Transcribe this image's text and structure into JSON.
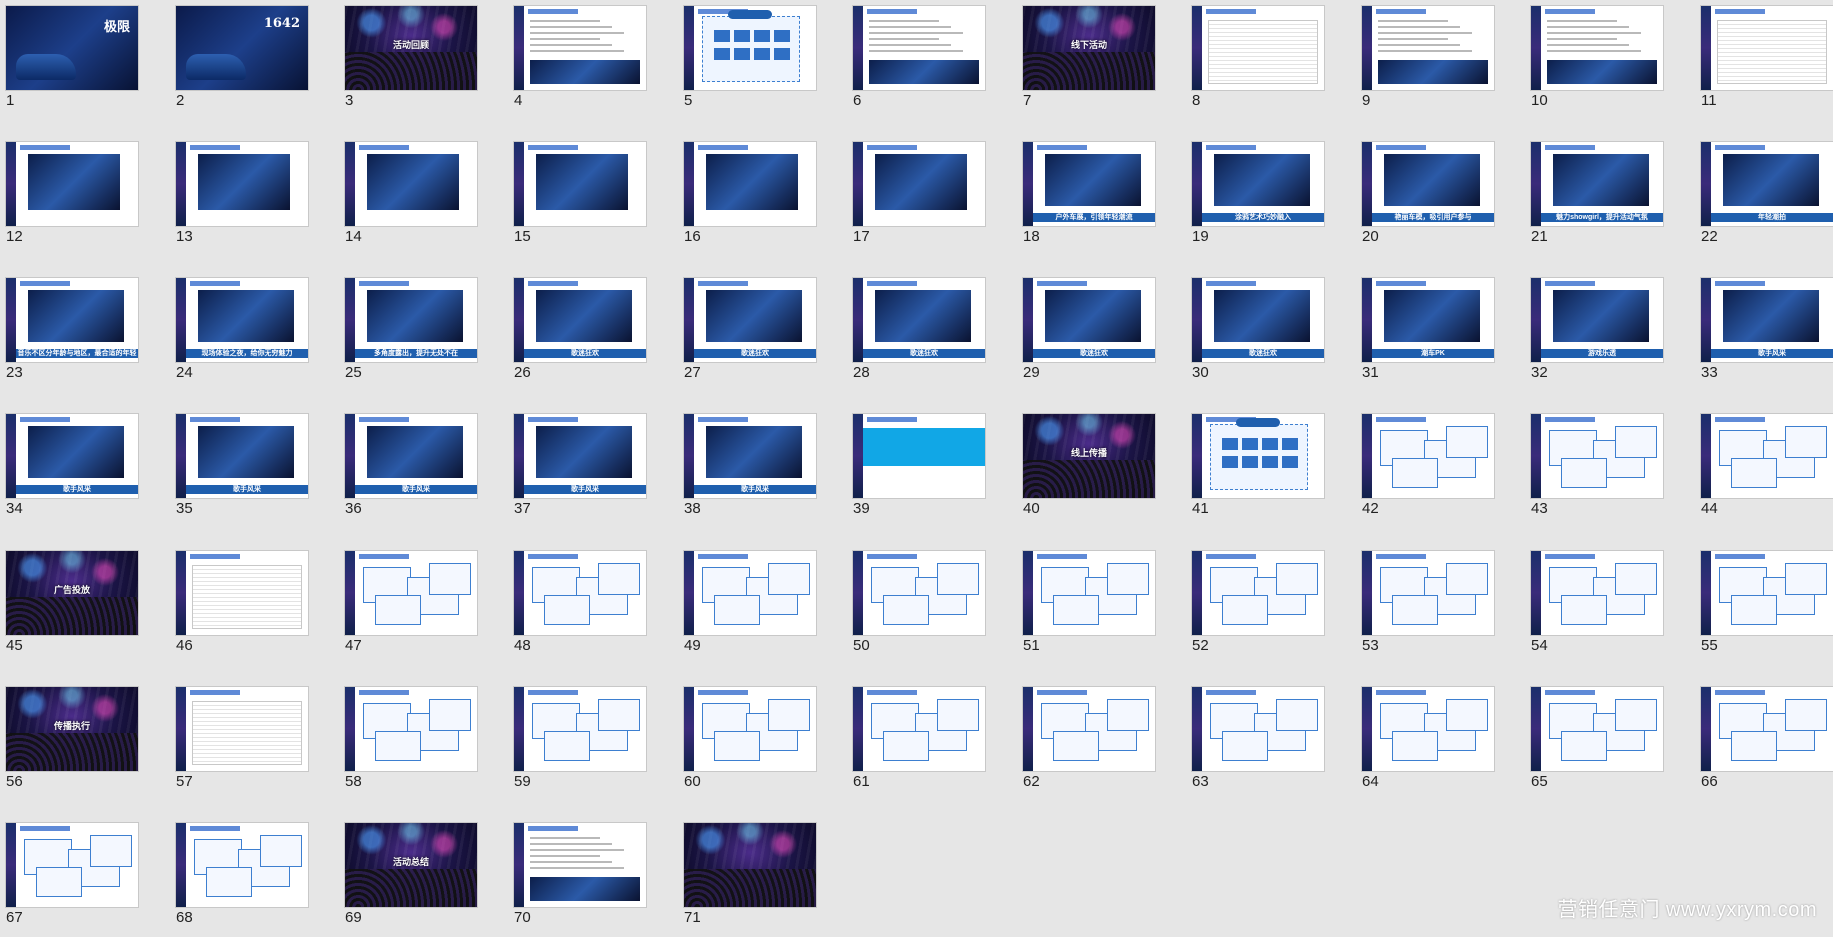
{
  "slides": [
    {
      "n": "1",
      "kind": "title",
      "caption": "",
      "word": "极限"
    },
    {
      "n": "2",
      "kind": "title",
      "caption": "",
      "word": "1642"
    },
    {
      "n": "3",
      "kind": "dark",
      "caption": "活动回顾"
    },
    {
      "n": "4",
      "kind": "doc",
      "caption": ""
    },
    {
      "n": "5",
      "kind": "blue",
      "caption": ""
    },
    {
      "n": "6",
      "kind": "doc",
      "caption": ""
    },
    {
      "n": "7",
      "kind": "dark",
      "caption": "线下活动"
    },
    {
      "n": "8",
      "kind": "table",
      "caption": ""
    },
    {
      "n": "9",
      "kind": "doc",
      "caption": ""
    },
    {
      "n": "10",
      "kind": "doc",
      "caption": ""
    },
    {
      "n": "11",
      "kind": "table",
      "caption": ""
    },
    {
      "n": "12",
      "kind": "photo",
      "caption": ""
    },
    {
      "n": "13",
      "kind": "photo",
      "caption": ""
    },
    {
      "n": "14",
      "kind": "photo",
      "caption": ""
    },
    {
      "n": "15",
      "kind": "photo",
      "caption": ""
    },
    {
      "n": "16",
      "kind": "photo",
      "caption": ""
    },
    {
      "n": "17",
      "kind": "photo",
      "caption": ""
    },
    {
      "n": "18",
      "kind": "photo",
      "caption": "户外车展，引领年轻潮流"
    },
    {
      "n": "19",
      "kind": "photo",
      "caption": "涂鸦艺术巧妙融入"
    },
    {
      "n": "20",
      "kind": "photo",
      "caption": "艳丽车模，吸引用户参与"
    },
    {
      "n": "21",
      "kind": "photo",
      "caption": "魅力showgirl，提升活动气氛"
    },
    {
      "n": "22",
      "kind": "photo",
      "caption": "年轻潮拍"
    },
    {
      "n": "23",
      "kind": "photo",
      "caption": "音乐不区分年龄与地区，最合适的年轻"
    },
    {
      "n": "24",
      "kind": "photo",
      "caption": "现场体验之夜，给你无穷魅力"
    },
    {
      "n": "25",
      "kind": "photo",
      "caption": "多角度露出，提升无处不在"
    },
    {
      "n": "26",
      "kind": "photo",
      "caption": "歌迷狂欢"
    },
    {
      "n": "27",
      "kind": "photo",
      "caption": "歌迷狂欢"
    },
    {
      "n": "28",
      "kind": "photo",
      "caption": "歌迷狂欢"
    },
    {
      "n": "29",
      "kind": "photo",
      "caption": "歌迷狂欢"
    },
    {
      "n": "30",
      "kind": "photo",
      "caption": "歌迷狂欢"
    },
    {
      "n": "31",
      "kind": "photo",
      "caption": "潮车PK"
    },
    {
      "n": "32",
      "kind": "photo",
      "caption": "游戏乐透"
    },
    {
      "n": "33",
      "kind": "photo",
      "caption": "歌手风采"
    },
    {
      "n": "34",
      "kind": "photo",
      "caption": "歌手风采"
    },
    {
      "n": "35",
      "kind": "photo",
      "caption": "歌手风采"
    },
    {
      "n": "36",
      "kind": "photo",
      "caption": "歌手风采"
    },
    {
      "n": "37",
      "kind": "photo",
      "caption": "歌手风采"
    },
    {
      "n": "38",
      "kind": "photo",
      "caption": "歌手风采"
    },
    {
      "n": "39",
      "kind": "cyan",
      "caption": ""
    },
    {
      "n": "40",
      "kind": "dark",
      "caption": "线上传播"
    },
    {
      "n": "41",
      "kind": "blue",
      "caption": ""
    },
    {
      "n": "42",
      "kind": "boxes",
      "caption": ""
    },
    {
      "n": "43",
      "kind": "boxes",
      "caption": ""
    },
    {
      "n": "44",
      "kind": "boxes",
      "caption": ""
    },
    {
      "n": "45",
      "kind": "dark",
      "caption": "广告投放"
    },
    {
      "n": "46",
      "kind": "table",
      "caption": ""
    },
    {
      "n": "47",
      "kind": "boxes",
      "caption": ""
    },
    {
      "n": "48",
      "kind": "boxes",
      "caption": ""
    },
    {
      "n": "49",
      "kind": "boxes",
      "caption": ""
    },
    {
      "n": "50",
      "kind": "boxes",
      "caption": ""
    },
    {
      "n": "51",
      "kind": "boxes",
      "caption": ""
    },
    {
      "n": "52",
      "kind": "boxes",
      "caption": ""
    },
    {
      "n": "53",
      "kind": "boxes",
      "caption": ""
    },
    {
      "n": "54",
      "kind": "boxes",
      "caption": ""
    },
    {
      "n": "55",
      "kind": "boxes",
      "caption": ""
    },
    {
      "n": "56",
      "kind": "dark",
      "caption": "传播执行"
    },
    {
      "n": "57",
      "kind": "table",
      "caption": ""
    },
    {
      "n": "58",
      "kind": "boxes",
      "caption": ""
    },
    {
      "n": "59",
      "kind": "boxes",
      "caption": ""
    },
    {
      "n": "60",
      "kind": "boxes",
      "caption": ""
    },
    {
      "n": "61",
      "kind": "boxes",
      "caption": ""
    },
    {
      "n": "62",
      "kind": "boxes",
      "caption": ""
    },
    {
      "n": "63",
      "kind": "boxes",
      "caption": ""
    },
    {
      "n": "64",
      "kind": "boxes",
      "caption": ""
    },
    {
      "n": "65",
      "kind": "boxes",
      "caption": ""
    },
    {
      "n": "66",
      "kind": "boxes",
      "caption": ""
    },
    {
      "n": "67",
      "kind": "boxes",
      "caption": ""
    },
    {
      "n": "68",
      "kind": "boxes",
      "caption": ""
    },
    {
      "n": "69",
      "kind": "dark",
      "caption": "活动总结"
    },
    {
      "n": "70",
      "kind": "doc",
      "caption": ""
    },
    {
      "n": "71",
      "kind": "dark",
      "caption": ""
    }
  ],
  "watermark": "营销任意门 www.yxrym.com"
}
